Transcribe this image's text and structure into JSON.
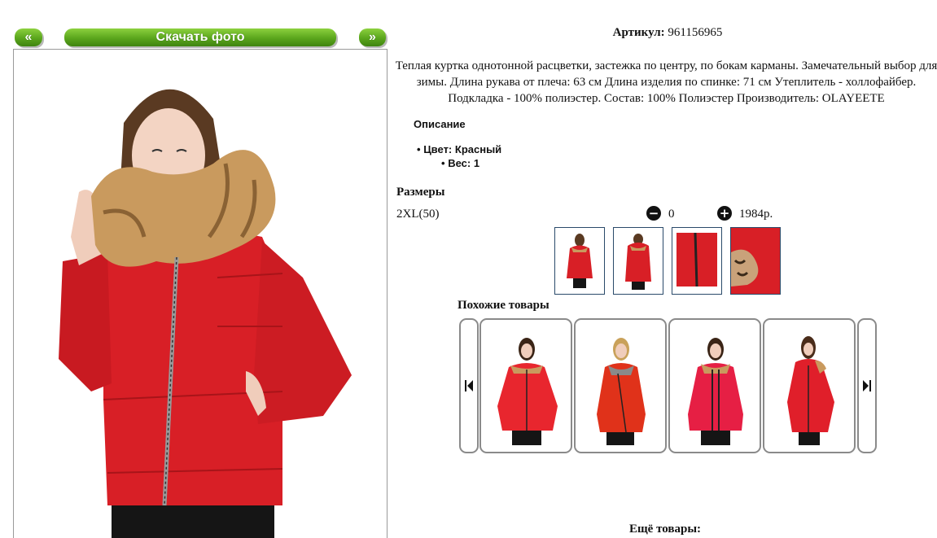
{
  "nav": {
    "prev_label": "«",
    "download_label": "Скачать фото",
    "next_label": "»"
  },
  "product": {
    "article_label": "Артикул:",
    "article_value": "961156965",
    "description": "Теплая куртка однотонной расцветки, застежка по центру, по бокам карманы. Замечательный выбор для зимы. Длина рукава от плеча: 63 см Длина изделия по спинке: 71 см Утеплитель - холлофайбер. Подкладка - 100% полиэстер. Состав: 100% Полиэстер Производитель: OLAYEETE",
    "details_heading": "Описание",
    "details": [
      {
        "label": "Цвет:",
        "value": "Красный"
      },
      {
        "label": "Вес:",
        "value": "1"
      }
    ],
    "sizes_heading": "Размеры",
    "sizes": [
      {
        "size": "2XL(50)",
        "quantity": "0",
        "price": "1984р."
      }
    ]
  },
  "thumbnails": [
    "thumb-front",
    "thumb-back",
    "thumb-zipper",
    "thumb-fur-detail"
  ],
  "similar": {
    "heading": "Похожие товары",
    "items": [
      "similar-item-1",
      "similar-item-2",
      "similar-item-3",
      "similar-item-4"
    ]
  },
  "more": {
    "heading": "Ещё товары:"
  },
  "colors": {
    "accent_green": "#5aa51c",
    "jacket_red": "#d81f26"
  },
  "icons": {
    "minus": "minus-circle-icon",
    "plus": "plus-circle-icon",
    "prev": "skip-back-icon",
    "next": "skip-forward-icon"
  }
}
